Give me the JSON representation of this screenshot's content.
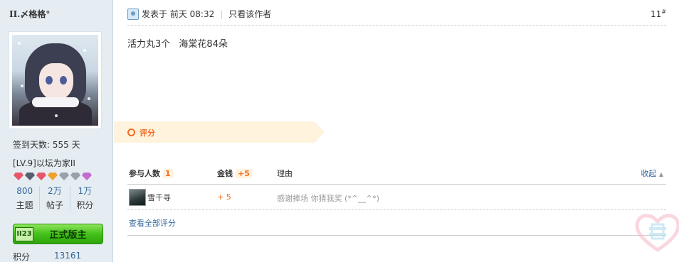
{
  "user": {
    "name": "II.〆格格°",
    "sign_days": "签到天数: 555 天",
    "level": "[LV.9]以坛为家II",
    "medal_colors": [
      "#e8566b",
      "#555f6e",
      "#e8566b",
      "#f0a030",
      "#9aa0aa",
      "#9aa0aa",
      "#c46bd0"
    ],
    "stats": [
      {
        "value": "800",
        "label": "主题"
      },
      {
        "value": "2万",
        "label": "帖子"
      },
      {
        "value": "1万",
        "label": "积分"
      }
    ],
    "rank_no": "II23",
    "rank_label": "正式版主",
    "points_label": "积分",
    "points_value": "13161"
  },
  "post": {
    "posted_prefix": "发表于 前天 08:32",
    "author_only": "只看该作者",
    "floor": "11",
    "floor_mark": "#",
    "content": [
      "活力丸3个",
      "海棠花84朵"
    ]
  },
  "rating": {
    "tab_label": "评分",
    "headers": {
      "participants": "参与人数",
      "participants_count": "1",
      "money": "金钱",
      "money_total": "+5",
      "reason": "理由",
      "collapse": "收起"
    },
    "rows": [
      {
        "user": "雪千寻",
        "amount": "+ 5",
        "reason": "感谢捧场 你猜我奖 (*^__^*)"
      }
    ],
    "view_all": "查看全部评分"
  },
  "colors": {
    "sidebar_bg": "#e5edf2",
    "accent_orange": "#f36c21",
    "link_blue": "#336699",
    "rank_green": "#43c11a"
  }
}
